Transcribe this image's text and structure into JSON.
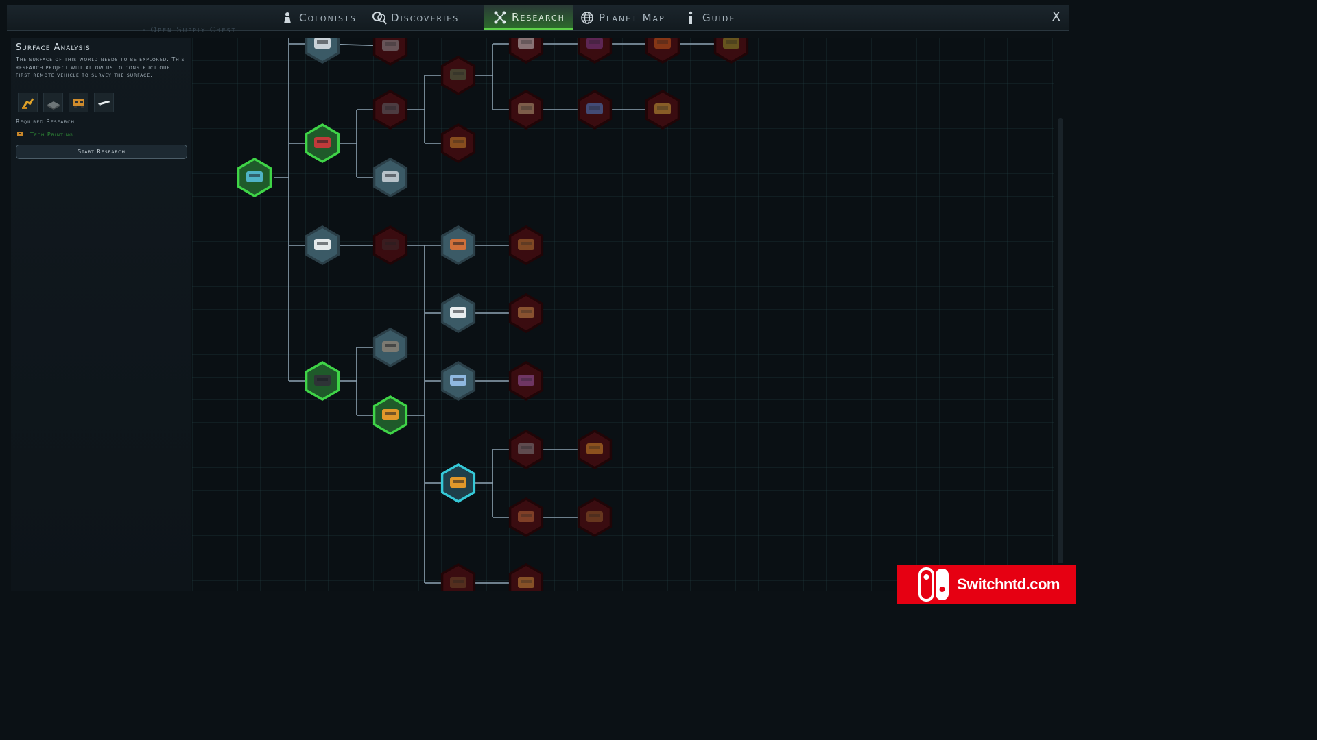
{
  "nav": {
    "tabs": [
      {
        "label": "Colonists",
        "icon": "colonist-icon",
        "active": false
      },
      {
        "label": "Discoveries",
        "icon": "magnifier-icon",
        "active": false
      },
      {
        "label": "Research",
        "icon": "network-icon",
        "active": true
      },
      {
        "label": "Planet Map",
        "icon": "globe-icon",
        "active": false
      },
      {
        "label": "Guide",
        "icon": "info-icon",
        "active": false
      }
    ],
    "close_label": "X"
  },
  "background_text": "- Open Supply Chest",
  "panel": {
    "title": "Surface Analysis",
    "description": "The surface of this world needs to be explored. This research project will allow us to construct our first remote vehicle to survey the surface.",
    "unlock_icons": [
      "robot-arm-icon",
      "floor-panel-icon",
      "rover-icon",
      "plate-icon"
    ],
    "required_label": "Required Research",
    "required_item": "Tech Printing",
    "start_button": "Start Research"
  },
  "tree": {
    "node_colors": {
      "completed": "#3fd447",
      "available": "#3b5a66",
      "selected": "#35c9d8",
      "locked": "#3a0c10"
    },
    "nodes": [
      {
        "id": "root",
        "state": "completed",
        "icon": "server-rack-icon"
      },
      {
        "id": "n-a1",
        "state": "available",
        "icon": "drill-icon"
      },
      {
        "id": "n-a2",
        "state": "locked",
        "icon": "helmet-icon"
      },
      {
        "id": "n-b",
        "state": "completed",
        "icon": "toolbox-icon"
      },
      {
        "id": "n-b1",
        "state": "locked",
        "icon": "cylinder-icon"
      },
      {
        "id": "n-b2",
        "state": "available",
        "icon": "plate-icon"
      },
      {
        "id": "n-b3",
        "state": "locked",
        "icon": "crate-icon"
      },
      {
        "id": "n-b4",
        "state": "locked",
        "icon": "barrel-icon"
      },
      {
        "id": "n-b5",
        "state": "locked",
        "icon": "vent-icon"
      },
      {
        "id": "n-b6",
        "state": "locked",
        "icon": "gear-icon"
      },
      {
        "id": "n-b7",
        "state": "locked",
        "icon": "flag-icon"
      },
      {
        "id": "n-b8",
        "state": "locked",
        "icon": "pod-icon"
      },
      {
        "id": "n-b9",
        "state": "locked",
        "icon": "sack-icon"
      },
      {
        "id": "n-b10",
        "state": "locked",
        "icon": "cloth-icon"
      },
      {
        "id": "n-b11",
        "state": "locked",
        "icon": "leaf-icon"
      },
      {
        "id": "n-c",
        "state": "available",
        "icon": "chair-icon"
      },
      {
        "id": "n-c1",
        "state": "locked",
        "icon": "box-icon"
      },
      {
        "id": "n-c2",
        "state": "available",
        "icon": "coil-icon"
      },
      {
        "id": "n-c3",
        "state": "locked",
        "icon": "spring-icon"
      },
      {
        "id": "n-c4",
        "state": "available",
        "icon": "shoe-icon"
      },
      {
        "id": "n-c5",
        "state": "locked",
        "icon": "boot-icon"
      },
      {
        "id": "n-c6",
        "state": "available",
        "icon": "panel-icon"
      },
      {
        "id": "n-c7",
        "state": "locked",
        "icon": "tarp-icon"
      },
      {
        "id": "n-d",
        "state": "completed",
        "icon": "floor-tile-icon"
      },
      {
        "id": "n-d1",
        "state": "available",
        "icon": "rubble-icon"
      },
      {
        "id": "n-d2",
        "state": "completed",
        "icon": "printer-icon"
      },
      {
        "id": "n-d3",
        "state": "selected",
        "icon": "rover-icon"
      },
      {
        "id": "n-d4",
        "state": "locked",
        "icon": "rock-icon"
      },
      {
        "id": "n-d5",
        "state": "locked",
        "icon": "ore-icon"
      },
      {
        "id": "n-d6",
        "state": "locked",
        "icon": "mushroom-icon"
      },
      {
        "id": "n-d7",
        "state": "locked",
        "icon": "seed-icon"
      },
      {
        "id": "n-e1",
        "state": "locked",
        "icon": "machine-icon"
      },
      {
        "id": "n-e2",
        "state": "locked",
        "icon": "robot-icon"
      }
    ]
  },
  "watermark": {
    "text": "Switchntd.com",
    "logo": "switch-logo-icon",
    "color": "#e60012"
  }
}
